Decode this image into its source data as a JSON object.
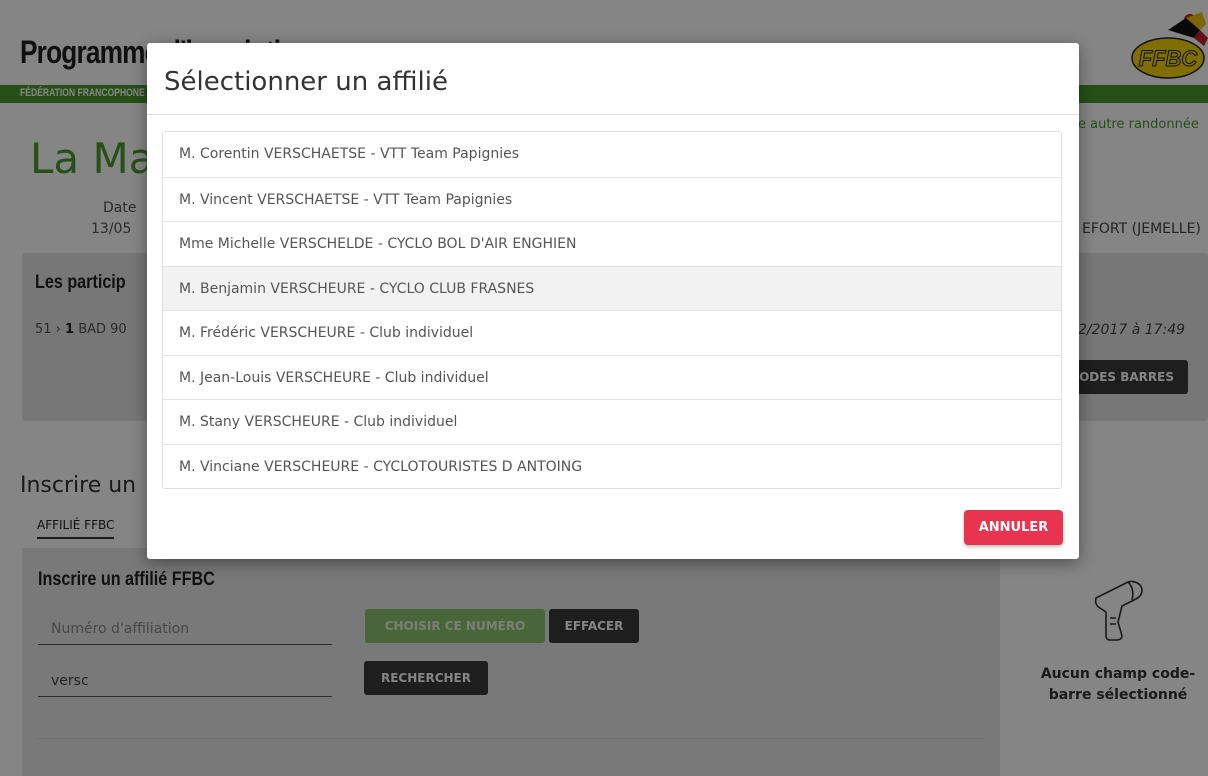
{
  "header": {
    "app_title": "Programme d'inscription",
    "federation": "FÉDÉRATION FRANCOPHONE BELGE DES CYCLOTOURISTES",
    "logo_text": "FFBC",
    "other_ride_link": "e autre randonnée"
  },
  "ride": {
    "title": "La Ma",
    "date_label": "Date",
    "date_value": "13/05",
    "location": "EFORT (JEMELLE)"
  },
  "participants": {
    "title": "Les particip",
    "stats_prefix": "51 › ",
    "stats_count": "1",
    "stats_suffix": " BAD 90",
    "last_update": "2/2017 à 17:49",
    "barcode_button": "ODES BARRES"
  },
  "register": {
    "title": "Inscrire un",
    "tab_label": "AFFILIÉ FFBC",
    "form_title": "Inscrire un affilié FFBC",
    "number_placeholder": "Numéro d'affiliation",
    "search_value": "versc",
    "choose_button": "CHOISIR CE NUMÉRO",
    "clear_button": "EFFACER",
    "search_button": "RECHERCHER"
  },
  "scanner": {
    "icon": "barcode-scanner-icon",
    "status": "Aucun champ code-barre sélectionné"
  },
  "modal": {
    "title": "Sélectionner un affilié",
    "items": [
      "M. Corentin VERSCHAETSE - VTT Team Papignies",
      "M. Vincent VERSCHAETSE - VTT Team Papignies",
      "Mme Michelle VERSCHELDE - CYCLO BOL D'AIR ENGHIEN",
      "M. Benjamin VERSCHEURE - CYCLO CLUB FRASNES",
      "M. Frédéric VERSCHEURE - Club individuel",
      "M. Jean-Louis VERSCHEURE - Club individuel",
      "M. Stany VERSCHEURE - Club individuel",
      "M. Vinciane VERSCHEURE - CYCLOTOURISTES D ANTOING"
    ],
    "hovered_index": 3,
    "cancel_button": "ANNULER"
  },
  "colors": {
    "brand_green": "#4a9a2e",
    "cancel_red": "#e8344e",
    "dark_button": "#3a3a3a"
  }
}
